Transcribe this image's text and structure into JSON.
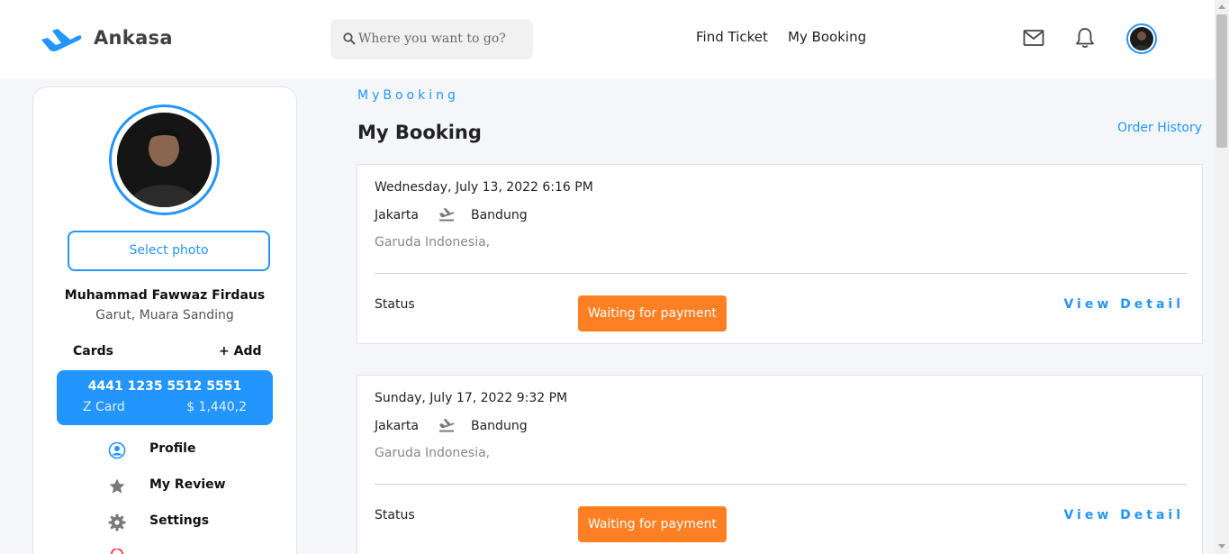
{
  "header": {
    "brand": "Ankasa",
    "search_placeholder": "Where you want to go?",
    "nav": [
      "Find Ticket",
      "My Booking"
    ],
    "icons": [
      "plane-logo-icon",
      "search-icon",
      "mail-icon",
      "bell-icon",
      "avatar"
    ]
  },
  "sidebar": {
    "select_photo": "Select photo",
    "name": "Muhammad Fawwaz Firdaus",
    "location": "Garut, Muara Sanding",
    "cards_label": "Cards",
    "add_label": "+ Add",
    "card": {
      "number": "4441 1235 5512 5551",
      "type": "Z Card",
      "balance": "$ 1,440,2"
    },
    "menu": [
      {
        "label": "Profile",
        "icon": "user-circle-icon"
      },
      {
        "label": "My Review",
        "icon": "star-icon"
      },
      {
        "label": "Settings",
        "icon": "gear-icon"
      }
    ]
  },
  "main": {
    "breadcrumb": "MyBooking",
    "title": "My Booking",
    "order_history": "Order History",
    "bookings": [
      {
        "date": "Wednesday, July 13, 2022 6:16 PM",
        "from": "Jakarta",
        "to": "Bandung",
        "airline": "Garuda Indonesia,",
        "status_label": "Status",
        "status": "Waiting for payment",
        "detail": "View Detail"
      },
      {
        "date": "Sunday, July 17, 2022 9:32 PM",
        "from": "Jakarta",
        "to": "Bandung",
        "airline": "Garuda Indonesia,",
        "status_label": "Status",
        "status": "Waiting for payment",
        "detail": "View Detail"
      }
    ]
  },
  "colors": {
    "accent": "#2395ff",
    "status_pending": "#ff7f23"
  }
}
